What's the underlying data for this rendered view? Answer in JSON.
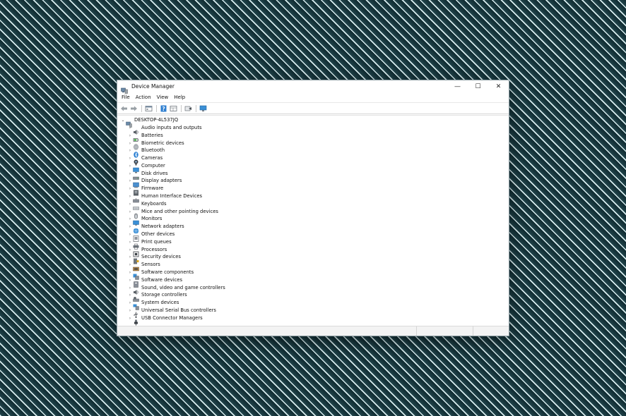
{
  "window": {
    "title": "Device Manager",
    "controls": {
      "minimize": "—",
      "maximize": "☐",
      "close": "✕"
    }
  },
  "menu": [
    "File",
    "Action",
    "View",
    "Help"
  ],
  "toolbar": {
    "buttons": [
      "back-icon",
      "forward-icon",
      "properties-icon",
      "help-icon",
      "view-icon",
      "update-driver-icon",
      "scan-hardware-icon"
    ]
  },
  "tree": {
    "root": {
      "label": "DESKTOP-4L537JQ",
      "expanded": true
    },
    "items": [
      {
        "label": "Audio inputs and outputs",
        "icon": "speaker-icon"
      },
      {
        "label": "Batteries",
        "icon": "battery-icon"
      },
      {
        "label": "Biometric devices",
        "icon": "fingerprint-icon"
      },
      {
        "label": "Bluetooth",
        "icon": "bluetooth-icon"
      },
      {
        "label": "Cameras",
        "icon": "camera-icon"
      },
      {
        "label": "Computer",
        "icon": "computer-icon"
      },
      {
        "label": "Disk drives",
        "icon": "disk-drive-icon"
      },
      {
        "label": "Display adapters",
        "icon": "display-adapter-icon"
      },
      {
        "label": "Firmware",
        "icon": "firmware-icon"
      },
      {
        "label": "Human Interface Devices",
        "icon": "hid-icon"
      },
      {
        "label": "Keyboards",
        "icon": "keyboard-icon"
      },
      {
        "label": "Mice and other pointing devices",
        "icon": "mouse-icon"
      },
      {
        "label": "Monitors",
        "icon": "monitor-icon"
      },
      {
        "label": "Network adapters",
        "icon": "network-adapter-icon"
      },
      {
        "label": "Other devices",
        "icon": "other-device-icon"
      },
      {
        "label": "Print queues",
        "icon": "printer-icon"
      },
      {
        "label": "Processors",
        "icon": "processor-icon"
      },
      {
        "label": "Security devices",
        "icon": "security-device-icon"
      },
      {
        "label": "Sensors",
        "icon": "sensor-icon"
      },
      {
        "label": "Software components",
        "icon": "software-component-icon"
      },
      {
        "label": "Software devices",
        "icon": "software-device-icon"
      },
      {
        "label": "Sound, video and game controllers",
        "icon": "sound-controller-icon"
      },
      {
        "label": "Storage controllers",
        "icon": "storage-controller-icon"
      },
      {
        "label": "System devices",
        "icon": "system-device-icon"
      },
      {
        "label": "Universal Serial Bus controllers",
        "icon": "usb-icon"
      },
      {
        "label": "USB Connector Managers",
        "icon": "usb-connector-icon"
      }
    ]
  },
  "colors": {
    "accent": "#3a8fd6",
    "background_stripe_light": "#d9eef0",
    "background_stripe_dark": "#1b3a40"
  }
}
